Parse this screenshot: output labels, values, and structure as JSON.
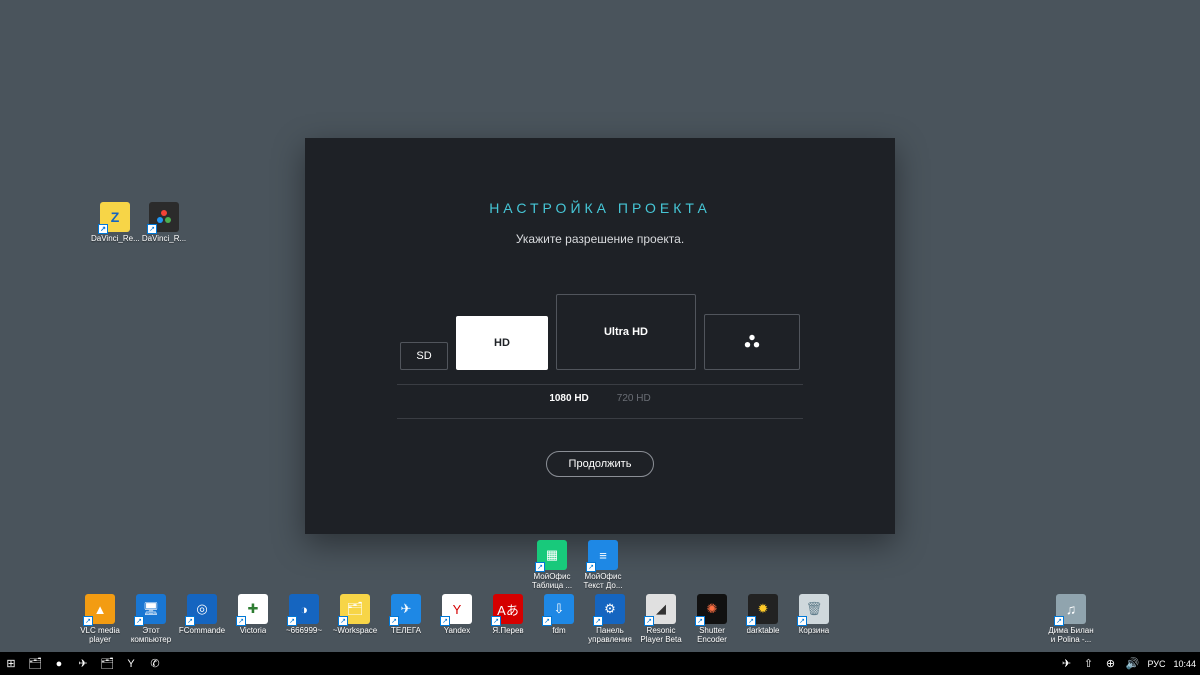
{
  "desktop": {
    "left": [
      {
        "label": "DaVinci_Re...",
        "bg": "#f7d547",
        "glyph": "Z"
      },
      {
        "label": "DaVinci_R...",
        "bg": "#2b2b2b",
        "glyph": "⋮"
      }
    ]
  },
  "dialog": {
    "title": "НАСТРОЙКА  ПРОЕКТА",
    "subtitle": "Укажите разрешение проекта.",
    "sd": "SD",
    "hd": "HD",
    "uhd": "Ultra HD",
    "sub_active": "1080 HD",
    "sub_inactive": "720 HD",
    "continue": "Продолжить"
  },
  "row1": [
    {
      "label": "МойОфис Таблица ...",
      "bg": "#18c97b",
      "glyph": "▦"
    },
    {
      "label": "МойОфис Текст До...",
      "bg": "#1e88e5",
      "glyph": "≡"
    }
  ],
  "row2": [
    {
      "label": "VLC media player",
      "bg": "#f39c12",
      "glyph": "▲"
    },
    {
      "label": "Этот компьютер",
      "bg": "#1976d2",
      "glyph": "🖥"
    },
    {
      "label": "FCommande",
      "bg": "#1565c0",
      "glyph": "◎"
    },
    {
      "label": "Victoria",
      "bg": "#ffffff",
      "glyph": "✚",
      "fg": "#2e7d32"
    },
    {
      "label": "~666999~",
      "bg": "#1565c0",
      "glyph": "◑"
    },
    {
      "label": "~Workspace",
      "bg": "#f7d547",
      "glyph": "🗂"
    },
    {
      "label": "ТЕЛЕГА",
      "bg": "#1e88e5",
      "glyph": "✈"
    },
    {
      "label": "Yandex",
      "bg": "#ffffff",
      "glyph": "Y",
      "fg": "#d50000"
    },
    {
      "label": "Я.Перев",
      "bg": "#d50000",
      "glyph": "Aあ"
    },
    {
      "label": "fdm",
      "bg": "#1e88e5",
      "glyph": "⇩"
    },
    {
      "label": "Панель управления",
      "bg": "#1565c0",
      "glyph": "⚙"
    },
    {
      "label": "Resonic Player Beta",
      "bg": "#e0e0e0",
      "glyph": "◢",
      "fg": "#333"
    },
    {
      "label": "Shutter Encoder",
      "bg": "#111111",
      "glyph": "✺",
      "fg": "#ff7043"
    },
    {
      "label": "darktable",
      "bg": "#222222",
      "glyph": "✹",
      "fg": "#ffca28"
    },
    {
      "label": "Корзина",
      "bg": "#cfd8dc",
      "glyph": "🗑",
      "fg": "#607d8b"
    }
  ],
  "row2_right": {
    "label": "Дима Билан и Polina -...",
    "bg": "#90a4ae",
    "glyph": "♫"
  },
  "taskbar": {
    "left_glyphs": [
      "⊞",
      "🗂",
      "●",
      "✈",
      "🗂",
      "Y",
      "✆"
    ],
    "tray_glyphs": [
      "✈",
      "⇧",
      "⊕",
      "🔊"
    ],
    "lang": "РУС",
    "time": "10:44"
  }
}
